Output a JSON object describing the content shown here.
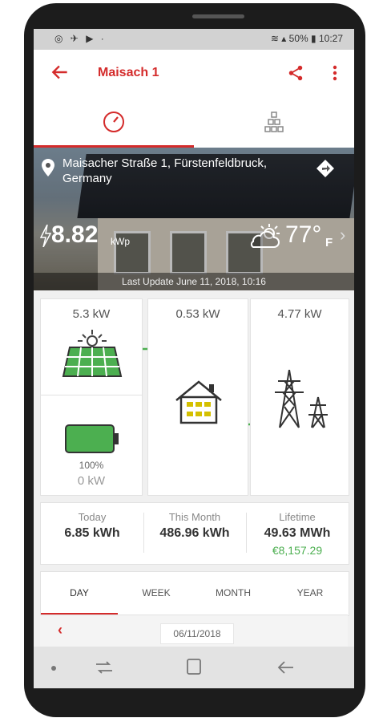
{
  "status_bar": {
    "left_icons": [
      "account-circle-icon",
      "cast-icon",
      "play-icon",
      "dot-icon"
    ],
    "right_text": "50% ▮ 10:27",
    "battery_percent": "50%",
    "time": "10:27"
  },
  "app_bar": {
    "title": "Maisach 1"
  },
  "site": {
    "address": "Maisacher Straße 1, Fürstenfeldbruck, Germany",
    "power_value": "8.82",
    "power_unit": "kWp",
    "temperature": "77°",
    "temperature_unit": "F",
    "last_update": "Last Update June 11, 2018, 10:16"
  },
  "flow": {
    "solar_kw": "5.3 kW",
    "home_kw": "0.53 kW",
    "grid_kw": "4.77 kW",
    "battery_percent": "100%",
    "battery_kw": "0 kW"
  },
  "stats": [
    {
      "label": "Today",
      "value": "6.85 kWh",
      "money": ""
    },
    {
      "label": "This Month",
      "value": "486.96 kWh",
      "money": ""
    },
    {
      "label": "Lifetime",
      "value": "49.63 MWh",
      "money": "€8,157.29"
    }
  ],
  "period_tabs": [
    "DAY",
    "WEEK",
    "MONTH",
    "YEAR"
  ],
  "date_nav": {
    "date": "06/11/2018"
  },
  "colors": {
    "accent": "#d42b2b",
    "green": "#4caf50",
    "tab_indicator": "#d42b2b"
  }
}
